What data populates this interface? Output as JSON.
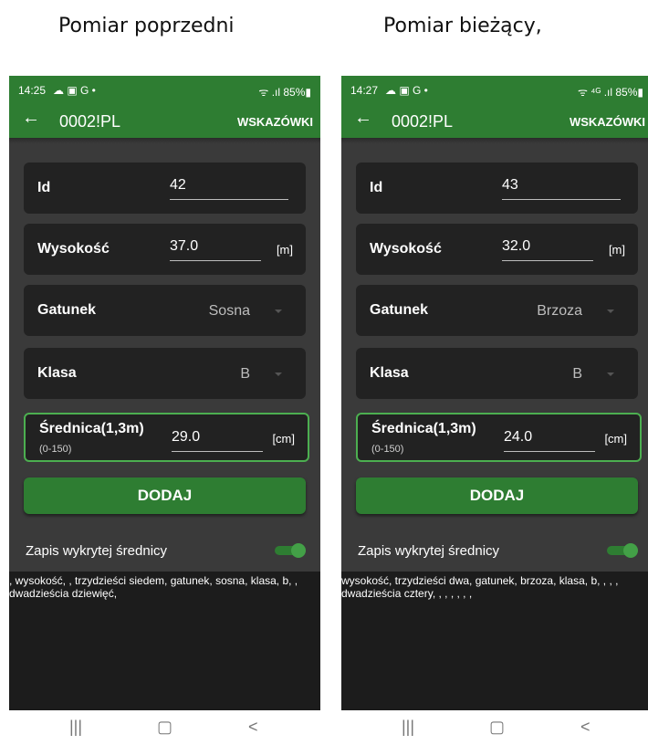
{
  "captions": {
    "left": "Pomiar poprzedni",
    "right": "Pomiar bieżący,"
  },
  "screens": [
    {
      "status": {
        "time": "14:25",
        "left_icons": "☁ ▣ G •",
        "right_icons": "ᯤ .ıl 85%▮"
      },
      "appbar": {
        "back": "←",
        "title": "0002!PL",
        "tips": "WSKAZÓWKI"
      },
      "fields": {
        "id_label": "Id",
        "id_value": "42",
        "height_label": "Wysokość",
        "height_value": "37.0",
        "height_unit": "[m]",
        "species_label": "Gatunek",
        "species_value": "Sosna",
        "class_label": "Klasa",
        "class_value": "B",
        "diameter_label": "Średnica(1,3m)",
        "diameter_range": "(0-150)",
        "diameter_value": "29.0",
        "diameter_unit": "[cm]"
      },
      "add_button": "DODAJ",
      "switch_label": "Zapis wykrytej średnicy",
      "switch_on": true,
      "log": ", wysokość, , trzydzieści siedem, gatunek, sosna, klasa, b, , dwadzieścia dziewięć,"
    },
    {
      "status": {
        "time": "14:27",
        "left_icons": "☁ ▣ G •",
        "right_icons": "ᯤ ⁴ᴳ .ıl 85%▮"
      },
      "appbar": {
        "back": "←",
        "title": "0002!PL",
        "tips": "WSKAZÓWKI"
      },
      "fields": {
        "id_label": "Id",
        "id_value": "43",
        "height_label": "Wysokość",
        "height_value": "32.0",
        "height_unit": "[m]",
        "species_label": "Gatunek",
        "species_value": "Brzoza",
        "class_label": "Klasa",
        "class_value": "B",
        "diameter_label": "Średnica(1,3m)",
        "diameter_range": "(0-150)",
        "diameter_value": "24.0",
        "diameter_unit": "[cm]"
      },
      "add_button": "DODAJ",
      "switch_label": "Zapis wykrytej średnicy",
      "switch_on": true,
      "log": "wysokość, trzydzieści dwa, gatunek, brzoza, klasa, b, , , , dwadzieścia cztery, , , , , , ,"
    }
  ],
  "navbar": {
    "recents": "|||",
    "home": "▢",
    "back": "<"
  },
  "colors": {
    "accent": "#2e7d32",
    "switch_thumb": "#43a047",
    "background": "#3a3a3a",
    "card": "#222222"
  }
}
